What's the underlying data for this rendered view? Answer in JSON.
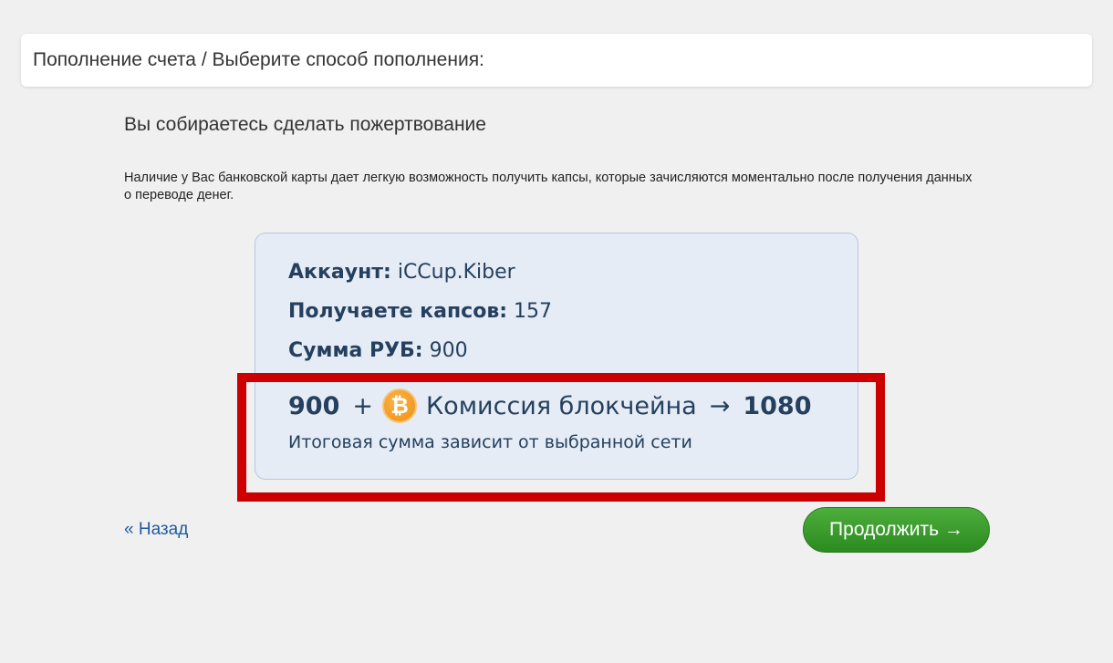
{
  "header": {
    "breadcrumb": "Пополнение счета / Выберите способ пополнения:"
  },
  "subtitle": "Вы собираетесь сделать пожертвование",
  "description": "Наличие у Вас банковской карты дает легкую возможность получить капсы, которые зачисляются моментально после получения данных о переводе денег.",
  "info": {
    "account_label": "Аккаунт:",
    "account_value": "iCCup.Kiber",
    "caps_label": "Получаете капсов:",
    "caps_value": "157",
    "sum_label": "Сумма РУБ:",
    "sum_value": "900",
    "total": {
      "base": "900",
      "plus": "+",
      "btc_symbol": "₿",
      "fee_label": "Комиссия блокчейна",
      "arrow": "→",
      "result": "1080"
    },
    "note": "Итоговая сумма зависит от выбранной сети"
  },
  "nav": {
    "back_label": "« Назад",
    "continue_label": "Продолжить →"
  },
  "colors": {
    "highlight": "#cc0000",
    "continue_button": "#3c9c2e",
    "link": "#1f5a9e",
    "info_text": "#25405e",
    "bitcoin": "#f7931a"
  },
  "icons": {
    "btc": "bitcoin-icon"
  }
}
